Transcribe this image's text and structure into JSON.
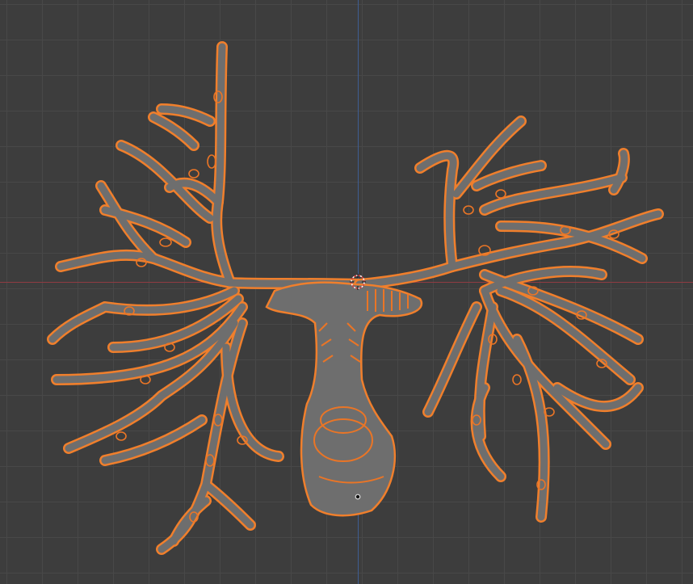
{
  "viewport": {
    "background_color": "#3d3d3d",
    "grid_color": "#484848",
    "x_axis_color": "#8f3b42",
    "y_axis_color": "#3f5e93"
  },
  "object": {
    "name": "bronchial-tree-mesh",
    "selected": true,
    "surface_color": "#6e6e6e",
    "outline_color": "#f07f2c",
    "detail_color": "#ea7526"
  },
  "cursor": {
    "icon": "3d-cursor-icon"
  },
  "origin": {
    "icon": "object-origin-icon"
  }
}
